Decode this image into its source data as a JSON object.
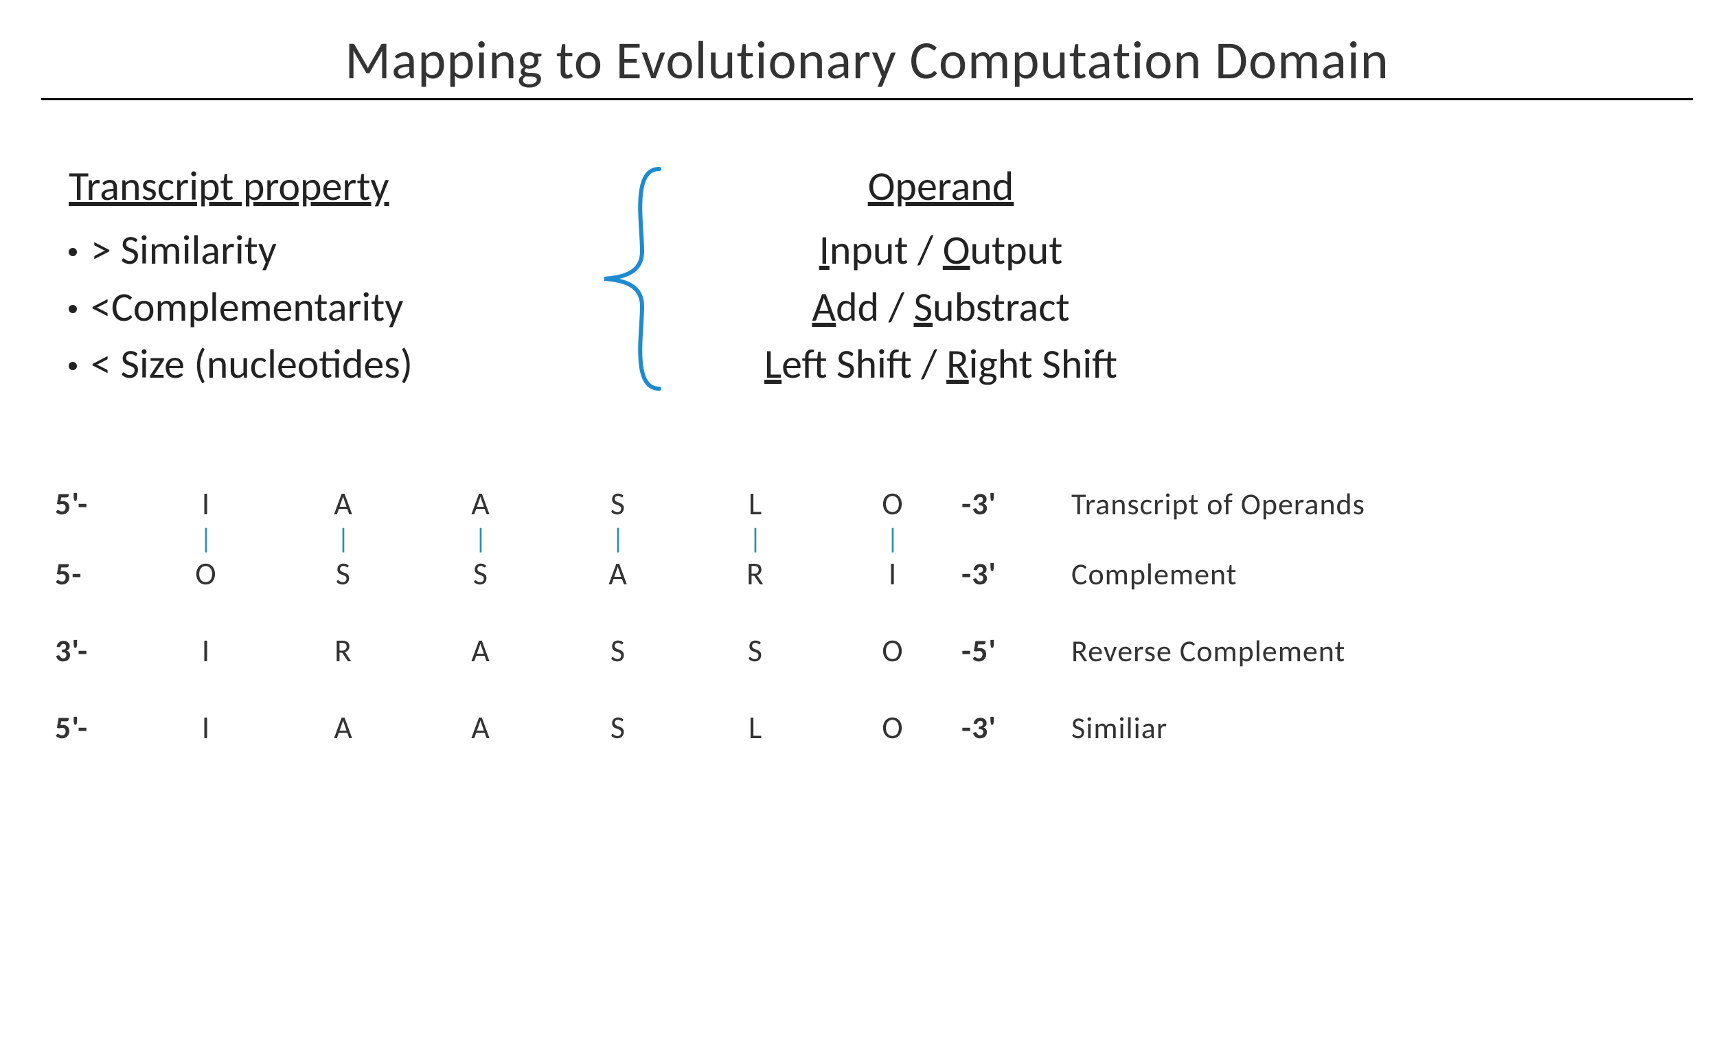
{
  "title": "Mapping to Evolutionary Computation Domain",
  "left": {
    "heading": "Transcript property",
    "items": [
      "> Similarity",
      "<Complementarity",
      "< Size (nucleotides)"
    ]
  },
  "right": {
    "heading": "Operand",
    "items": [
      {
        "a_u": "I",
        "a_rest": "nput",
        "b_u": "O",
        "b_rest": "utput"
      },
      {
        "a_u": "A",
        "a_rest": "dd",
        "b_u": "S",
        "b_rest": "ubstract"
      },
      {
        "a_u": "L",
        "a_rest": "eft Shift",
        "b_u": "R",
        "b_rest": "ight Shift"
      }
    ]
  },
  "sequences": {
    "rows": [
      {
        "l": "5'-",
        "c": [
          "I",
          "A",
          "A",
          "S",
          "L",
          "O"
        ],
        "r": "-3'",
        "label": "Transcript of Operands"
      },
      {
        "l": "5-",
        "c": [
          "O",
          "S",
          "S",
          "A",
          "R",
          "I"
        ],
        "r": "-3'",
        "label": "Complement"
      },
      {
        "l": "3'-",
        "c": [
          "I",
          "R",
          "A",
          "S",
          "S",
          "O"
        ],
        "r": "-5'",
        "label": "Reverse Complement"
      },
      {
        "l": "5'-",
        "c": [
          "I",
          "A",
          "A",
          "S",
          "L",
          "O"
        ],
        "r": "-3'",
        "label": "Similiar"
      }
    ],
    "pair_char": "|"
  }
}
